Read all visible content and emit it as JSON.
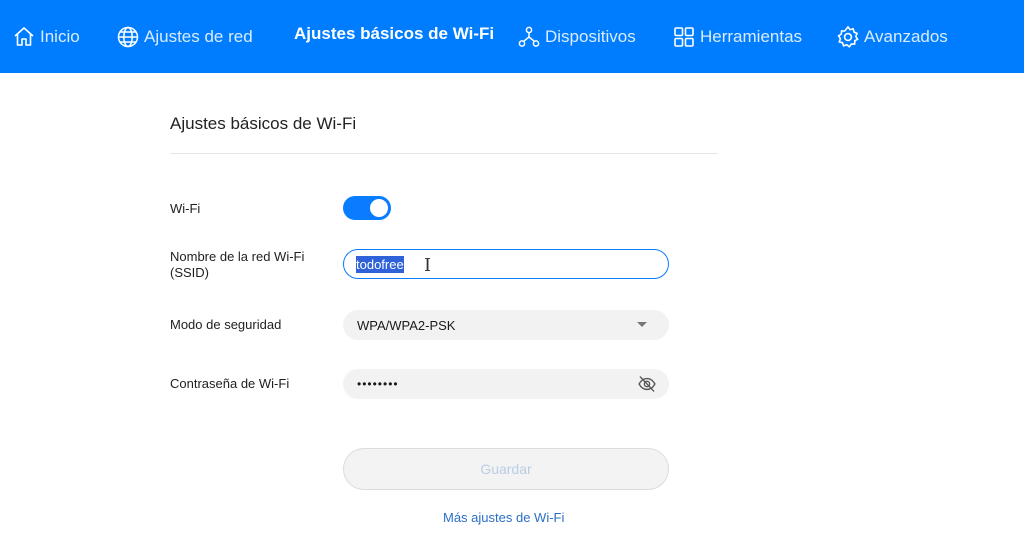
{
  "nav": {
    "items": [
      {
        "label": "Inicio",
        "icon": "home-icon"
      },
      {
        "label": "Ajustes de red",
        "icon": "globe-icon"
      },
      {
        "label": "Ajustes básicos de Wi-Fi",
        "icon": "",
        "active": true
      },
      {
        "label": "Dispositivos",
        "icon": "devices-icon"
      },
      {
        "label": "Herramientas",
        "icon": "grid-icon"
      },
      {
        "label": "Avanzados",
        "icon": "gear-icon"
      }
    ],
    "background": "#007dff"
  },
  "page": {
    "title": "Ajustes básicos de Wi-Fi"
  },
  "form": {
    "wifi": {
      "label": "Wi-Fi",
      "enabled": true
    },
    "ssid": {
      "label_line1": "Nombre de la red Wi-Fi",
      "label_line2": "(SSID)",
      "value": "todofree"
    },
    "security": {
      "label": "Modo de seguridad",
      "value": "WPA/WPA2-PSK"
    },
    "password": {
      "label": "Contraseña de Wi-Fi",
      "value": "••••••••",
      "icon": "eye-slash-icon"
    },
    "save_label": "Guardar",
    "more_link": "Más ajustes de Wi-Fi"
  },
  "colors": {
    "accent": "#0a7cff",
    "link": "#2b6fc5"
  }
}
